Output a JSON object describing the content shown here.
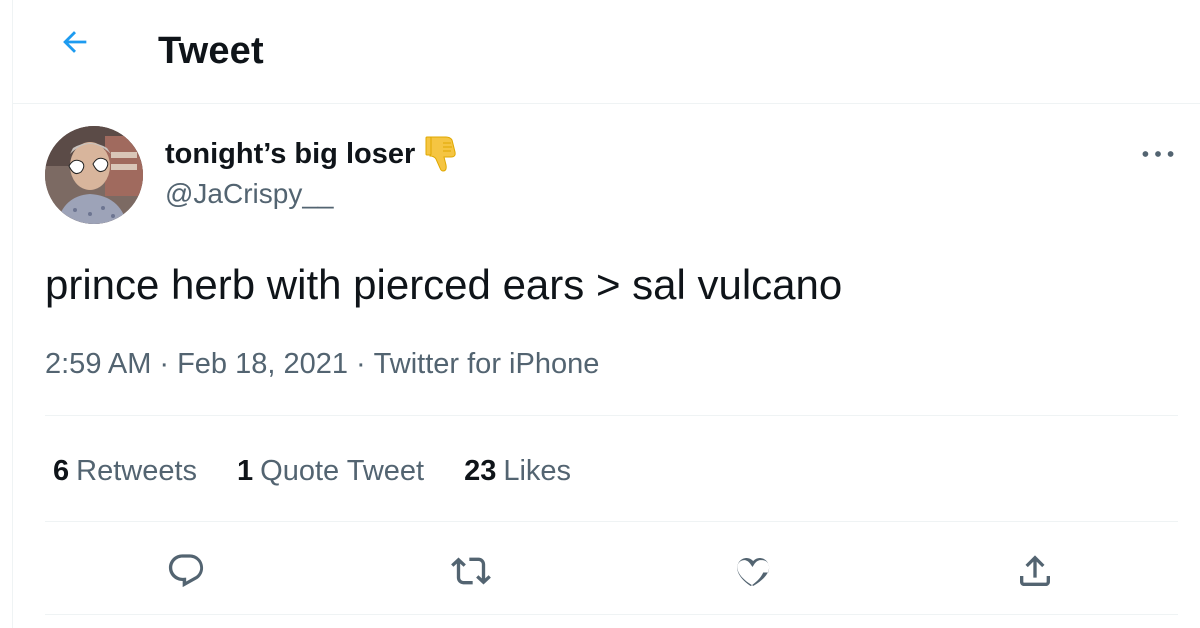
{
  "header": {
    "back_icon": "arrow-left-icon",
    "title": "Tweet"
  },
  "author": {
    "avatar_icon": "profile-photo",
    "display_name": "tonight’s big loser",
    "name_emoji": "thumbs-down-icon",
    "handle": "@JaCrispy__"
  },
  "menu": {
    "icon": "more-horizontal-icon"
  },
  "tweet": {
    "text": "prince herb with pierced ears > sal vulcano",
    "time": "2:59 AM",
    "separator": "·",
    "date": "Feb 18, 2021",
    "source": "Twitter for iPhone"
  },
  "stats": [
    {
      "count": "6",
      "label": "Retweets"
    },
    {
      "count": "1",
      "label": "Quote Tweet"
    },
    {
      "count": "23",
      "label": "Likes"
    }
  ],
  "actions": [
    {
      "name": "reply",
      "icon": "reply-icon"
    },
    {
      "name": "retweet",
      "icon": "retweet-icon"
    },
    {
      "name": "like",
      "icon": "heart-icon"
    },
    {
      "name": "share",
      "icon": "share-icon"
    }
  ],
  "colors": {
    "accent": "#1d9bf0",
    "text_primary": "#0f1419",
    "text_secondary": "#536471",
    "divider": "#eff3f4",
    "emoji_yellow": "#f5c542"
  }
}
